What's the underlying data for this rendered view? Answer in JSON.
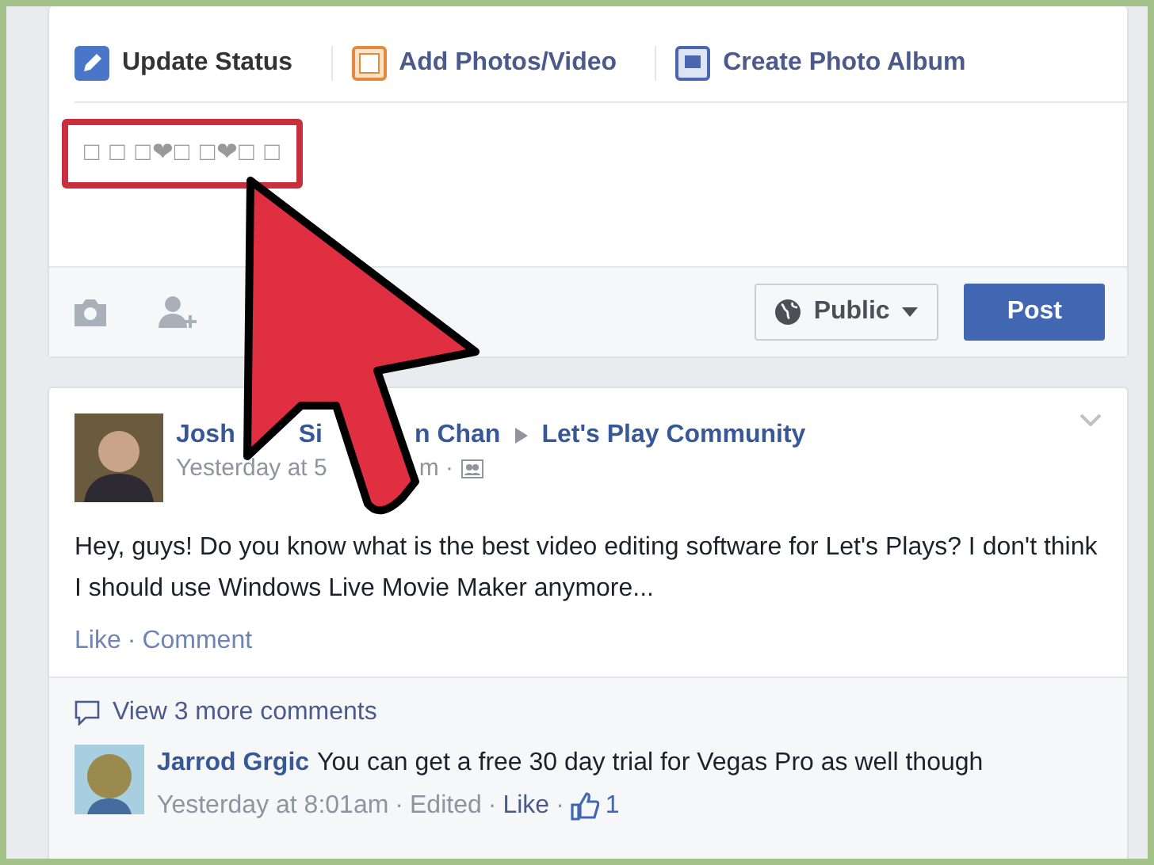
{
  "composer": {
    "tabs": [
      {
        "label": "Update Status",
        "selected": true
      },
      {
        "label": "Add Photos/Video",
        "selected": false
      },
      {
        "label": "Create Photo Album",
        "selected": false
      }
    ],
    "value": "□ □ □❤□ □❤□ □",
    "privacy": "Public",
    "post_button": "Post"
  },
  "post": {
    "author_parts": [
      "Josh",
      "Si",
      "n Chan"
    ],
    "group": "Let's Play Community",
    "time_parts": [
      "Yesterday at 5",
      "m ·"
    ],
    "text": "Hey, guys! Do you know what is the best video editing software for Let's Plays? I don't think I should use Windows Live Movie Maker anymore...",
    "actions": [
      "Like",
      "Comment"
    ],
    "separator": "·",
    "more_comments": "View 3 more comments",
    "comments": [
      {
        "author": "Jarrod Grgic",
        "text": "You can get a free 30 day trial for Vegas Pro as well though",
        "time": "Yesterday at 8:01am",
        "edited": "Edited",
        "like": "Like",
        "likes": "1",
        "separator": "·"
      }
    ]
  }
}
